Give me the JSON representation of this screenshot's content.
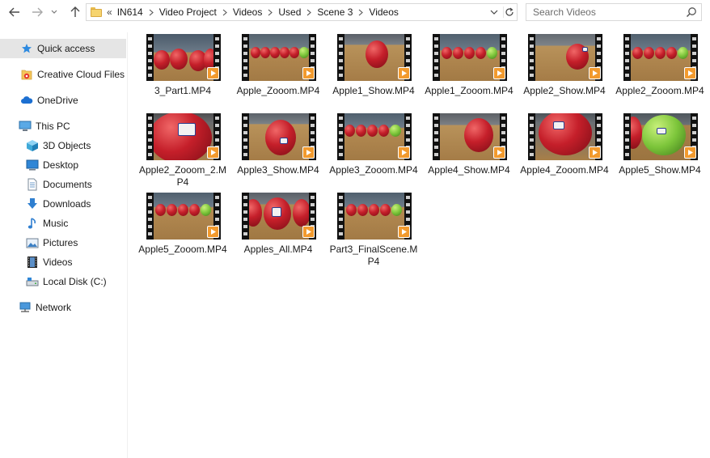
{
  "toolbar": {
    "back_label": "Back",
    "forward_label": "Forward",
    "recent_label": "Recent locations",
    "up_label": "Up"
  },
  "address": {
    "overflow": "«",
    "crumbs": [
      "IN614",
      "Video Project",
      "Videos",
      "Used",
      "Scene 3",
      "Videos"
    ]
  },
  "search": {
    "placeholder": "Search Videos"
  },
  "sidebar": {
    "items": [
      {
        "label": "Quick access",
        "icon": "star-icon",
        "selected": true
      },
      {
        "label": "Creative Cloud Files",
        "icon": "creative-cloud-icon"
      },
      {
        "label": "OneDrive",
        "icon": "cloud-icon"
      },
      {
        "label": "This PC",
        "icon": "computer-icon"
      },
      {
        "label": "3D Objects",
        "icon": "cube-icon"
      },
      {
        "label": "Desktop",
        "icon": "desktop-icon"
      },
      {
        "label": "Documents",
        "icon": "document-icon"
      },
      {
        "label": "Downloads",
        "icon": "download-icon"
      },
      {
        "label": "Music",
        "icon": "music-icon"
      },
      {
        "label": "Pictures",
        "icon": "pictures-icon"
      },
      {
        "label": "Videos",
        "icon": "film-icon"
      },
      {
        "label": "Local Disk (C:)",
        "icon": "drive-icon"
      },
      {
        "label": "Network",
        "icon": "network-icon"
      }
    ]
  },
  "files": [
    {
      "name": "3_Part1.MP4",
      "icon": "video-file-icon"
    },
    {
      "name": "Apple_Zooom.MP4",
      "icon": "video-file-icon"
    },
    {
      "name": "Apple1_Show.MP4",
      "icon": "video-file-icon"
    },
    {
      "name": "Apple1_Zooom.MP4",
      "icon": "video-file-icon"
    },
    {
      "name": "Apple2_Show.MP4",
      "icon": "video-file-icon"
    },
    {
      "name": "Apple2_Zooom.MP4",
      "icon": "video-file-icon"
    },
    {
      "name": "Apple2_Zooom_2.MP4",
      "icon": "video-file-icon"
    },
    {
      "name": "Apple3_Show.MP4",
      "icon": "video-file-icon"
    },
    {
      "name": "Apple3_Zooom.MP4",
      "icon": "video-file-icon"
    },
    {
      "name": "Apple4_Show.MP4",
      "icon": "video-file-icon"
    },
    {
      "name": "Apple4_Zooom.MP4",
      "icon": "video-file-icon"
    },
    {
      "name": "Apple5_Show.MP4",
      "icon": "video-file-icon"
    },
    {
      "name": "Apple5_Zooom.MP4",
      "icon": "video-file-icon"
    },
    {
      "name": "Apples_All.MP4",
      "icon": "video-file-icon"
    },
    {
      "name": "Part3_FinalScene.MP4",
      "icon": "video-file-icon"
    }
  ],
  "colors": {
    "selection": "#e5e5e5",
    "play_badge": "#f29a2e",
    "folder": "#f6d46f"
  }
}
